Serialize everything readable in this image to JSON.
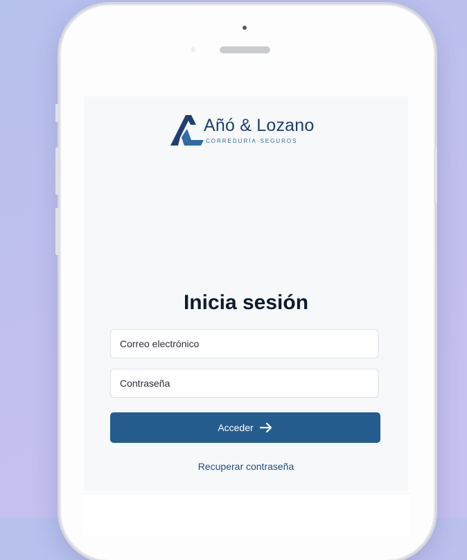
{
  "brand": {
    "name": "Añó & Lozano",
    "subtitle": "CORREDURÍA·SEGUROS"
  },
  "login": {
    "title": "Inicia sesión",
    "email_placeholder": "Correo electrónico",
    "password_placeholder": "Contraseña",
    "submit_label": "Acceder",
    "recover_label": "Recuperar contraseña"
  },
  "icons": {
    "logo": "al-logo-mark",
    "submit": "arrow-right-icon"
  },
  "colors": {
    "brand_dark": "#1f3f72",
    "brand_light": "#2f6aa5",
    "button": "#245c8e",
    "link": "#24507d"
  }
}
